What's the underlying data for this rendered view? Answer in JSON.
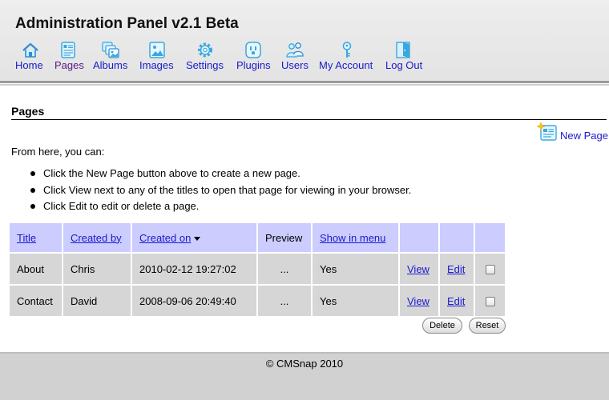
{
  "app_title": "Administration Panel v2.1 Beta",
  "nav": {
    "home": "Home",
    "pages": "Pages",
    "albums": "Albums",
    "images": "Images",
    "settings": "Settings",
    "plugins": "Plugins",
    "users": "Users",
    "my_account": "My Account",
    "log_out": "Log Out"
  },
  "icons": {
    "home": "home-icon",
    "pages": "pages-icon",
    "albums": "albums-icon",
    "images": "images-icon",
    "settings": "gear-icon",
    "plugins": "plug-icon",
    "users": "users-icon",
    "my_account": "key-icon",
    "log_out": "door-icon",
    "new_page": "new-page-icon"
  },
  "section": {
    "title": "Pages",
    "new_page_label": "New Page",
    "intro": "From here, you can:",
    "bullets": [
      "Click the New Page button above to create a new page.",
      "Click View next to any of the titles to open that page for viewing in your browser.",
      "Click Edit to edit or delete a page."
    ]
  },
  "table": {
    "headers": {
      "title": "Title",
      "created_by": "Created by",
      "created_on": "Created on",
      "preview": "Preview",
      "show_in_menu": "Show in menu"
    },
    "sort_column": "Created on",
    "rows": [
      {
        "title": "About",
        "created_by": "Chris",
        "created_on": "2010-02-12 19:27:02",
        "preview": "...",
        "show_in_menu": "Yes",
        "view": "View",
        "edit": "Edit",
        "checked": false
      },
      {
        "title": "Contact",
        "created_by": "David",
        "created_on": "2008-09-06 20:49:40",
        "preview": "...",
        "show_in_menu": "Yes",
        "view": "View",
        "edit": "Edit",
        "checked": false
      }
    ]
  },
  "buttons": {
    "delete": "Delete",
    "reset": "Reset"
  },
  "footer": "© CMSnap 2010",
  "colors": {
    "link": "#1a1acc",
    "link_visited": "#551a8b",
    "table_header_bg": "#ccccff",
    "table_cell_bg": "#d6d6d6",
    "icon_accent": "#3aa8e0"
  }
}
